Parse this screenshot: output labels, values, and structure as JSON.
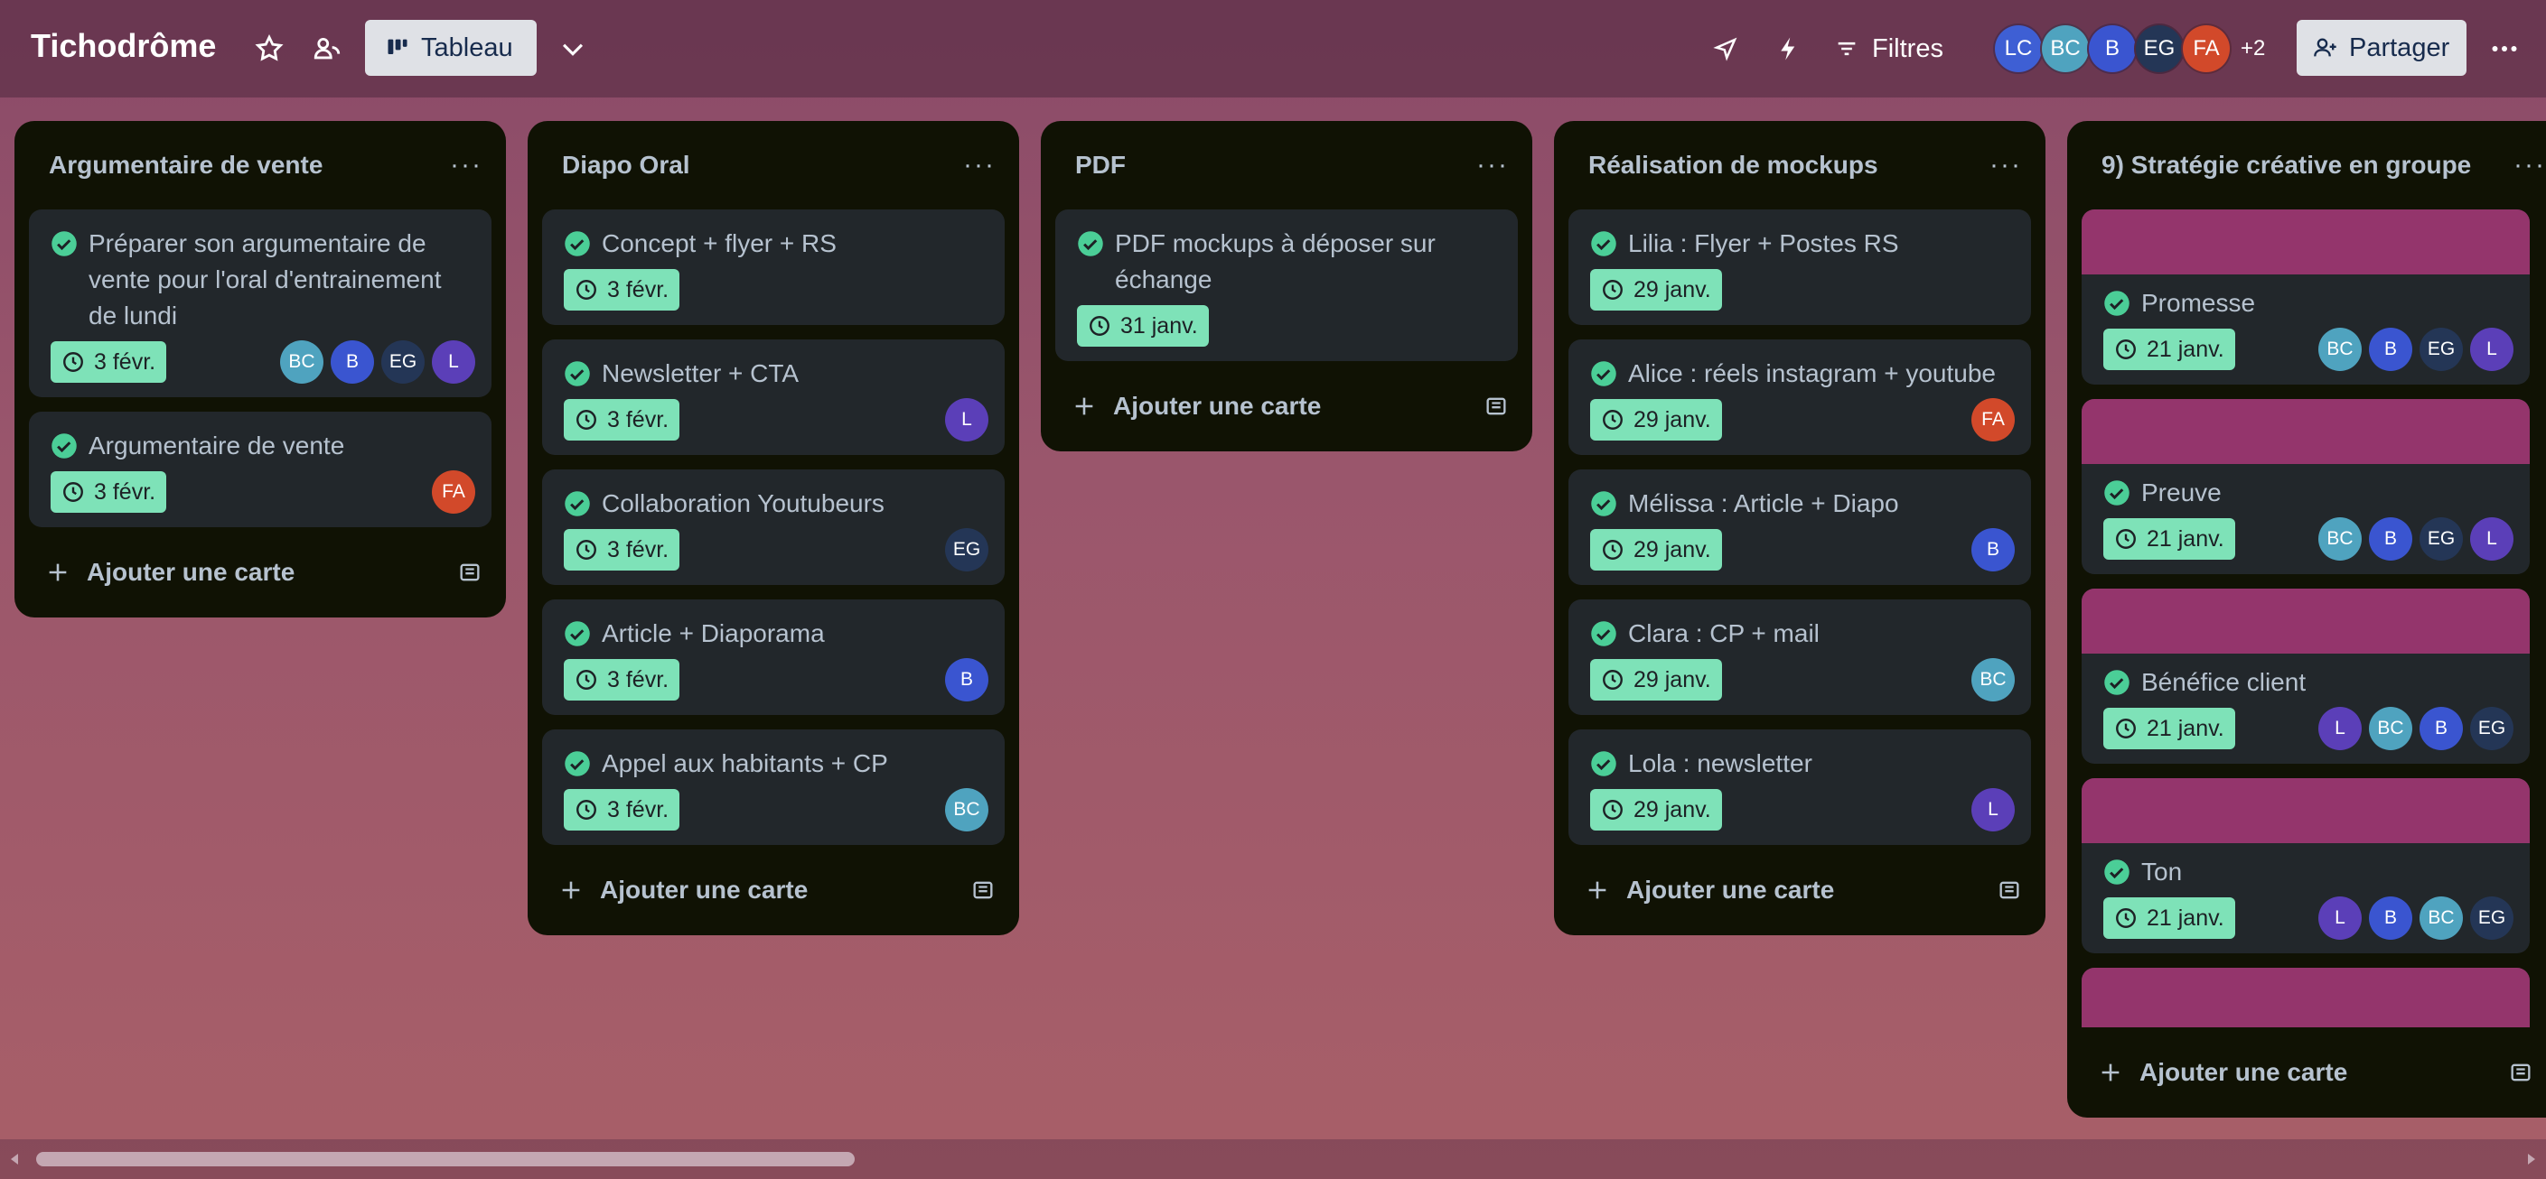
{
  "header": {
    "board_title": "Tichodrôme",
    "view_label": "Tableau",
    "filter_label": "Filtres",
    "share_label": "Partager",
    "more_members": "+2",
    "members": [
      {
        "initials": "LC",
        "color": "#3e5fd4"
      },
      {
        "initials": "BC",
        "color": "#4fa3bf"
      },
      {
        "initials": "B",
        "color": "#3a55d0"
      },
      {
        "initials": "EG",
        "color": "#243656"
      },
      {
        "initials": "FA",
        "color": "#d2492a"
      }
    ]
  },
  "colors": {
    "date_badge": "#7ee2b8",
    "list_bg": "#101204",
    "card_bg": "#22272b",
    "cover": "#94356c",
    "check": "#4bce97"
  },
  "lists": [
    {
      "title": "Argumentaire de vente",
      "add_label": "Ajouter une carte",
      "cards": [
        {
          "title": "Préparer son argumentaire de vente pour l'oral d'entrainement de lundi",
          "date": "3 févr."
        },
        {
          "title": "Argumentaire de vente",
          "date": "3 févr."
        }
      ]
    },
    {
      "title": "Diapo Oral",
      "add_label": "Ajouter une carte",
      "cards": [
        {
          "title": "Concept + flyer + RS",
          "date": "3 févr."
        },
        {
          "title": "Newsletter + CTA",
          "date": "3 févr."
        },
        {
          "title": "Collaboration Youtubeurs",
          "date": "3 févr."
        },
        {
          "title": "Article + Diaporama",
          "date": "3 févr."
        },
        {
          "title": "Appel aux habitants + CP",
          "date": "3 févr."
        }
      ]
    },
    {
      "title": "PDF",
      "add_label": "Ajouter une carte",
      "cards": [
        {
          "title": "PDF mockups à déposer sur échange",
          "date": "31 janv."
        }
      ]
    },
    {
      "title": "Réalisation de mockups",
      "add_label": "Ajouter une carte",
      "cards": [
        {
          "title": "Lilia : Flyer + Postes RS",
          "date": "29 janv."
        },
        {
          "title": "Alice : réels instagram + youtube",
          "date": "29 janv."
        },
        {
          "title": "Mélissa : Article + Diapo",
          "date": "29 janv."
        },
        {
          "title": "Clara : CP + mail",
          "date": "29 janv."
        },
        {
          "title": "Lola : newsletter",
          "date": "29 janv."
        }
      ]
    },
    {
      "title": "9) Stratégie créative en groupe",
      "add_label": "Ajouter une carte",
      "cards": [
        {
          "title": "Promesse",
          "date": "21 janv."
        },
        {
          "title": "Preuve",
          "date": "21 janv."
        },
        {
          "title": "Bénéfice client",
          "date": "21 janv."
        },
        {
          "title": "Ton",
          "date": "21 janv."
        }
      ]
    }
  ],
  "avatars": {
    "BC": {
      "initials": "BC",
      "color": "#4fa3bf"
    },
    "B": {
      "initials": "B",
      "color": "#3a55d0"
    },
    "EG": {
      "initials": "EG",
      "color": "#243656"
    },
    "L": {
      "initials": "L",
      "color": "#5b3fb8"
    },
    "FA": {
      "initials": "FA",
      "color": "#d2492a"
    }
  }
}
